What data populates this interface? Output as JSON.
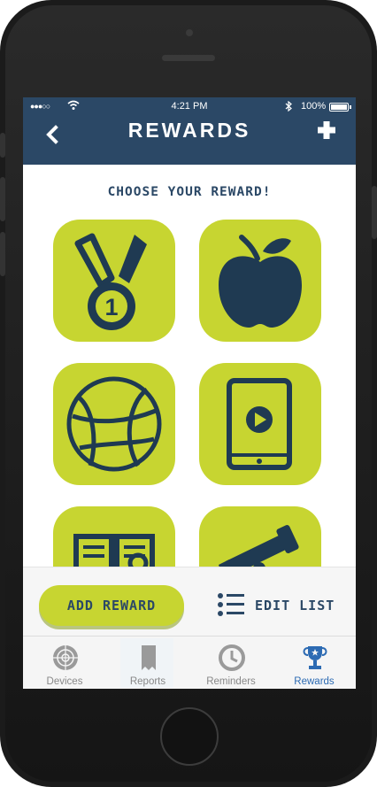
{
  "status_bar": {
    "signal": "●●●○○",
    "wifi_icon": "wifi-icon",
    "time": "4:21 PM",
    "bluetooth_icon": "bluetooth-icon",
    "battery": "100%"
  },
  "header": {
    "title": "REWARDS",
    "back_icon": "chevron-left-icon",
    "add_icon": "plus-icon"
  },
  "main": {
    "heading": "CHOOSE YOUR REWARD!",
    "rewards": [
      {
        "icon": "medal-icon"
      },
      {
        "icon": "apple-icon"
      },
      {
        "icon": "basketball-icon"
      },
      {
        "icon": "tablet-video-icon"
      },
      {
        "icon": "book-icon"
      },
      {
        "icon": "telescope-icon"
      }
    ]
  },
  "actions": {
    "add_reward": "ADD REWARD",
    "edit_list": "EDIT LIST"
  },
  "tabbar": {
    "tabs": [
      {
        "label": "Devices",
        "icon": "radar-icon",
        "active": false
      },
      {
        "label": "Reports",
        "icon": "receipt-icon",
        "active": false
      },
      {
        "label": "Reminders",
        "icon": "clock-icon",
        "active": false
      },
      {
        "label": "Rewards",
        "icon": "trophy-icon",
        "active": true
      }
    ]
  },
  "colors": {
    "navy": "#2b4866",
    "lime": "#c7d531",
    "active_tab": "#2d6bb3",
    "inactive_tab": "#888888"
  }
}
